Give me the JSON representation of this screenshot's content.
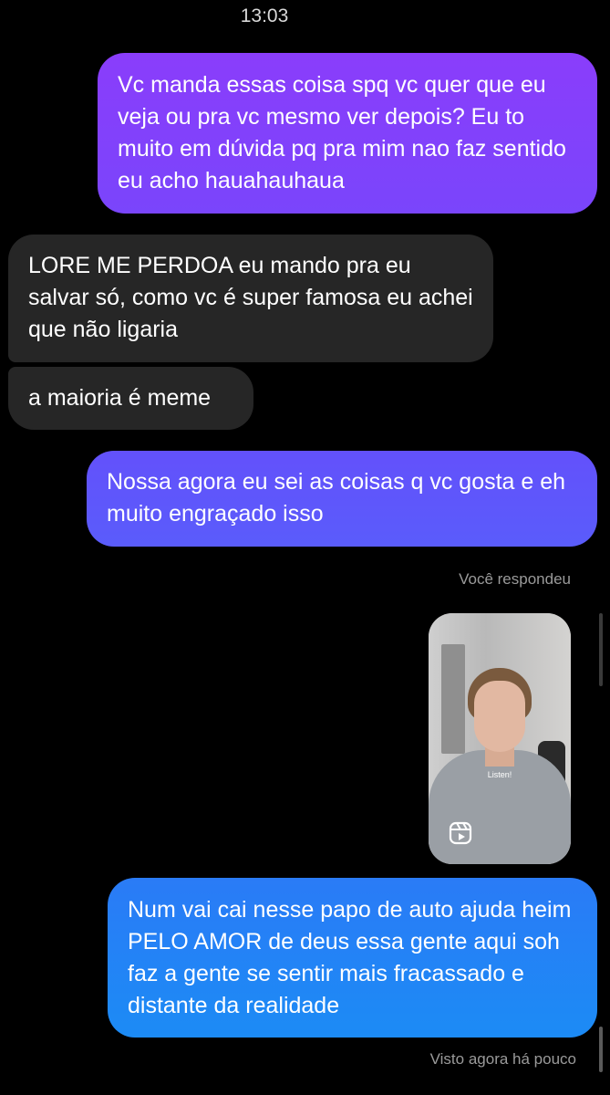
{
  "status": {
    "time": "13:03"
  },
  "messages": [
    {
      "id": "b1",
      "sender": "me",
      "text": "Vc manda essas coisa spq vc quer que eu veja ou pra vc mesmo ver depois? Eu to muito em dúvida pq pra mim nao faz sentido eu acho hauahauhaua"
    },
    {
      "id": "b2",
      "sender": "them",
      "text": "LORE ME PERDOA eu mando pra eu salvar só, como vc é super famosa eu achei que não ligaria"
    },
    {
      "id": "b3",
      "sender": "them",
      "text": "a maioria é meme"
    },
    {
      "id": "b4",
      "sender": "me",
      "text": "Nossa agora eu sei as coisas q vc gosta e eh muito engraçado isso"
    },
    {
      "id": "b5",
      "sender": "me",
      "text": "Num vai cai nesse papo de auto ajuda heim PELO AMOR de deus essa gente aqui soh faz a gente se sentir mais fracassado e distante da realidade"
    }
  ],
  "reply_label": "Você respondeu",
  "reel": {
    "caption": "Listen!",
    "icon": "reels-icon"
  },
  "seen_label": "Visto agora há pouco",
  "colors": {
    "bubble_top": "#8a3dfb",
    "bubble_mid": "#6351fb",
    "bubble_bottom": "#2a7bf6",
    "bubble_incoming": "#262626",
    "background": "#000000"
  }
}
